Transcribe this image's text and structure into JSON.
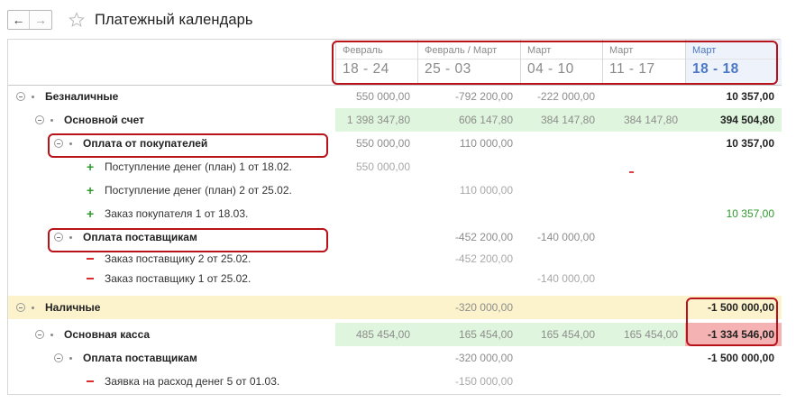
{
  "toolbar": {
    "back_label": "←",
    "forward_label": "→",
    "title": "Платежный календарь"
  },
  "icons": {
    "favorite": "star-outline-icon",
    "expander": "collapse-circle-icon",
    "income": "plus-icon",
    "expense": "minus-icon"
  },
  "colors": {
    "income_row": "#dff5dd",
    "cash_group": "#fcf3cc",
    "negative_alert": "#f5b2b2",
    "highlight_frame": "#b8121b",
    "active_period": "#4b78c4"
  },
  "columns": [
    {
      "month": "Февраль",
      "dates": "18 - 24"
    },
    {
      "month": "Февраль / Март",
      "dates": "25 - 03"
    },
    {
      "month": "Март",
      "dates": "04 - 10"
    },
    {
      "month": "Март",
      "dates": "11 - 17"
    },
    {
      "month": "Март",
      "dates": "18 - 18"
    }
  ],
  "rows": [
    {
      "label": "Безналичные",
      "values": [
        "550 000,00",
        "-792 200,00",
        "-222 000,00",
        "",
        "10 357,00"
      ]
    },
    {
      "label": "Основной счет",
      "values": [
        "1 398 347,80",
        "606 147,80",
        "384 147,80",
        "384 147,80",
        "394 504,80"
      ]
    },
    {
      "label": "Оплата от покупателей",
      "values": [
        "550 000,00",
        "110 000,00",
        "",
        "",
        "10 357,00"
      ]
    },
    {
      "label": "Поступление денег (план) 1 от 18.02.",
      "values": [
        "550 000,00",
        "",
        "",
        "",
        ""
      ]
    },
    {
      "label": "Поступление денег (план) 2 от 25.02.",
      "values": [
        "",
        "110 000,00",
        "",
        "",
        ""
      ]
    },
    {
      "label": "Заказ покупателя 1 от 18.03.",
      "values": [
        "",
        "",
        "",
        "",
        "10 357,00"
      ]
    },
    {
      "label": "Оплата поставщикам",
      "values": [
        "",
        "-452 200,00",
        "-140 000,00",
        "",
        ""
      ]
    },
    {
      "label": "Заказ поставщику 2 от 25.02.",
      "values": [
        "",
        "-452 200,00",
        "",
        "",
        ""
      ]
    },
    {
      "label": "Заказ поставщику 1 от 25.02.",
      "values": [
        "",
        "",
        "-140 000,00",
        "",
        ""
      ]
    },
    {
      "label": "Наличные",
      "values": [
        "",
        "-320 000,00",
        "",
        "",
        "-1 500 000,00"
      ]
    },
    {
      "label": "Основная касса",
      "values": [
        "485 454,00",
        "165 454,00",
        "165 454,00",
        "165 454,00",
        "-1 334 546,00"
      ]
    },
    {
      "label": "Оплата поставщикам",
      "values": [
        "",
        "-320 000,00",
        "",
        "",
        "-1 500 000,00"
      ]
    },
    {
      "label": "Заявка на расход денег 5 от 01.03.",
      "values": [
        "",
        "-150 000,00",
        "",
        "",
        ""
      ]
    }
  ]
}
